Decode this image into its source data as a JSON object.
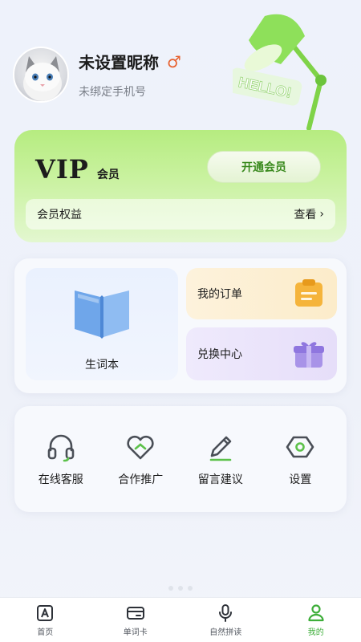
{
  "profile": {
    "nickname": "未设置昵称",
    "gender_symbol": "♂",
    "phone": "未绑定手机号"
  },
  "decoration": {
    "lamp_text": "HELLO!"
  },
  "vip": {
    "title": "VIP",
    "subtitle": "会员",
    "open_button": "开通会员",
    "benefits_label": "会员权益",
    "benefits_link": "查看",
    "chevron": "›"
  },
  "features": {
    "wordbook": "生词本",
    "orders": "我的订单",
    "redeem": "兑换中心"
  },
  "services": [
    {
      "label": "在线客服",
      "icon": "headset-icon"
    },
    {
      "label": "合作推广",
      "icon": "handshake-heart-icon"
    },
    {
      "label": "留言建议",
      "icon": "pencil-icon"
    },
    {
      "label": "设置",
      "icon": "settings-hexagon-icon"
    }
  ],
  "tabs": [
    {
      "label": "首页",
      "icon": "home-icon",
      "active": false
    },
    {
      "label": "单词卡",
      "icon": "card-icon",
      "active": false
    },
    {
      "label": "自然拼读",
      "icon": "microphone-icon",
      "active": false
    },
    {
      "label": "我的",
      "icon": "person-icon",
      "active": true
    }
  ],
  "colors": {
    "accent_green": "#3eae3a",
    "vip_green": "#b6ec80",
    "gender_orange": "#e7612f",
    "orders_bg": "#fcecca",
    "redeem_bg": "#e6def9"
  }
}
